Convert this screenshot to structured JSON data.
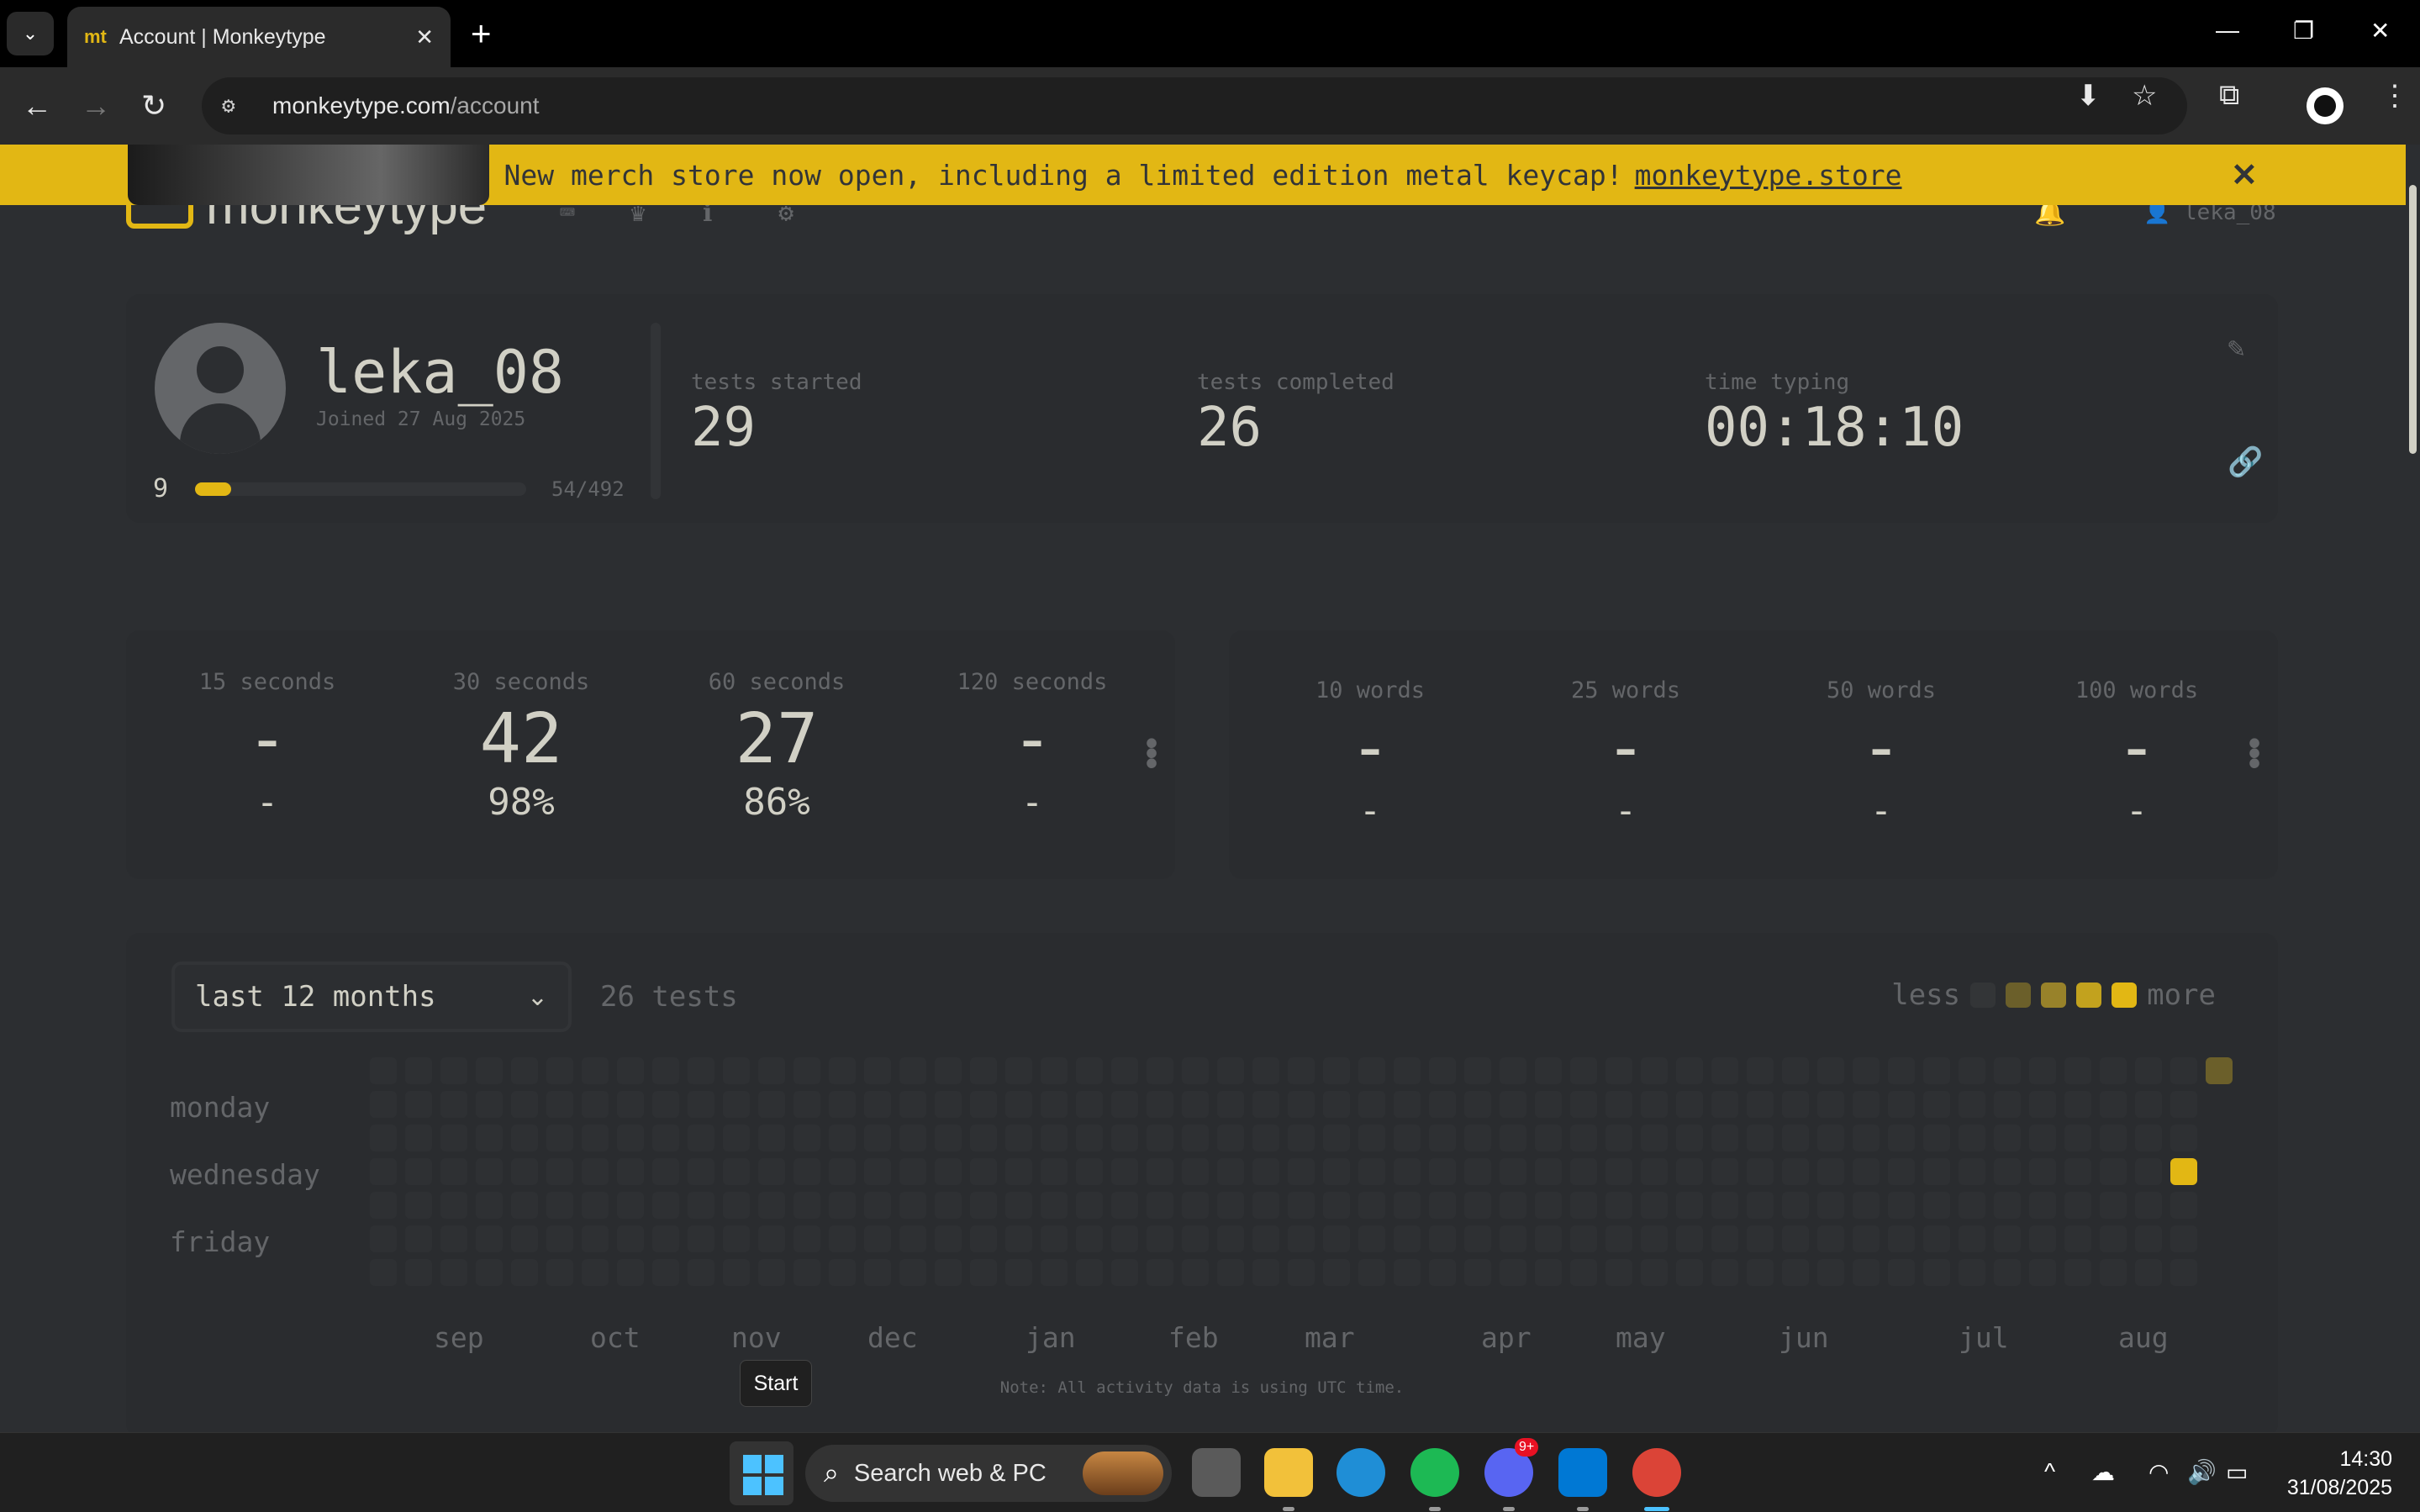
{
  "browser": {
    "tab_title": "Account | Monkeytype",
    "tab_favicon": "mt",
    "url_host": "monkeytype.com",
    "url_path": "/account"
  },
  "banner": {
    "message": "New merch store now open, including a limited edition metal keycap!",
    "link": "monkeytype.store",
    "close_icon": "✕"
  },
  "site": {
    "logo": "monkeytype",
    "user": "leka_08",
    "accent": "#e2b714"
  },
  "profile": {
    "username": "leka_08",
    "joined": "Joined 27 Aug 2025",
    "level": "9",
    "xp_text": "54/492",
    "xp_fraction": 0.11,
    "stats": [
      {
        "label": "tests started",
        "value": "29"
      },
      {
        "label": "tests completed",
        "value": "26"
      },
      {
        "label": "time typing",
        "value": "00:18:10"
      }
    ]
  },
  "time_pbs": [
    {
      "label": "15 seconds",
      "wpm": "-",
      "acc": "-"
    },
    {
      "label": "30 seconds",
      "wpm": "42",
      "acc": "98%"
    },
    {
      "label": "60 seconds",
      "wpm": "27",
      "acc": "86%"
    },
    {
      "label": "120 seconds",
      "wpm": "-",
      "acc": "-"
    }
  ],
  "word_pbs": [
    {
      "label": "10 words",
      "wpm": "-",
      "acc": "-"
    },
    {
      "label": "25 words",
      "wpm": "-",
      "acc": "-"
    },
    {
      "label": "50 words",
      "wpm": "-",
      "acc": "-"
    },
    {
      "label": "100 words",
      "wpm": "-",
      "acc": "-"
    }
  ],
  "activity": {
    "range": "last 12 months",
    "tests": "26 tests",
    "legend_less": "less",
    "legend_more": "more",
    "legend_colors": [
      "#333537",
      "#6b5f2a",
      "#98822a",
      "#c2a21e",
      "#e2b714"
    ],
    "days": [
      "monday",
      "wednesday",
      "friday"
    ],
    "months": [
      "sep",
      "oct",
      "nov",
      "dec",
      "jan",
      "feb",
      "mar",
      "apr",
      "may",
      "jun",
      "jul",
      "aug"
    ],
    "note": "Note: All activity data is using UTC time."
  },
  "tooltip": "Start",
  "taskbar": {
    "search": "Search web & PC",
    "time": "14:30",
    "date": "31/08/2025",
    "discord_badge": "9+"
  }
}
